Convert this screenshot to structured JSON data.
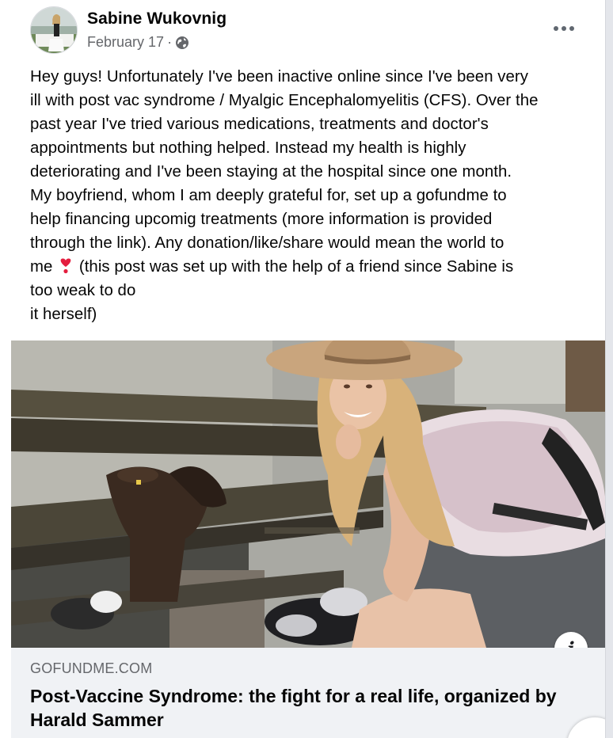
{
  "post": {
    "author": "Sabine Wukovnig",
    "date": "February 17",
    "separator": " · ",
    "audience_icon": "globe-icon",
    "more_icon": "more-options-icon",
    "text_part1": "Hey guys! Unfortunately I've been inactive online since I've been very\nill with post vac syndrome / Myalgic Encephalomyelitis (CFS). Over the\npast year I've tried various medications, treatments and doctor's\nappointments but nothing helped. Instead my health is highly\ndeteriorating and I've been staying at the hospital since one month.\nMy boyfriend, whom I am deeply grateful for, set up a gofundme to\nhelp financing upcomig treatments (more information is provided\nthrough the link). Any donation/like/share would mean the world to\nme ",
    "heart_emoji": "heart-exclamation-icon",
    "text_part2": " (this post was set up with the help of a friend since Sabine is\ntoo weak to do\nit herself)"
  },
  "link": {
    "domain": "GOFUNDME.COM",
    "title": "Post-Vaccine Syndrome: the fight for a real life, organized by Harald Sammer",
    "info_icon": "info-icon"
  },
  "colors": {
    "text": "#050505",
    "secondary": "#65676b",
    "preview_bg": "#f0f2f5",
    "heart": "#e41e3f"
  }
}
